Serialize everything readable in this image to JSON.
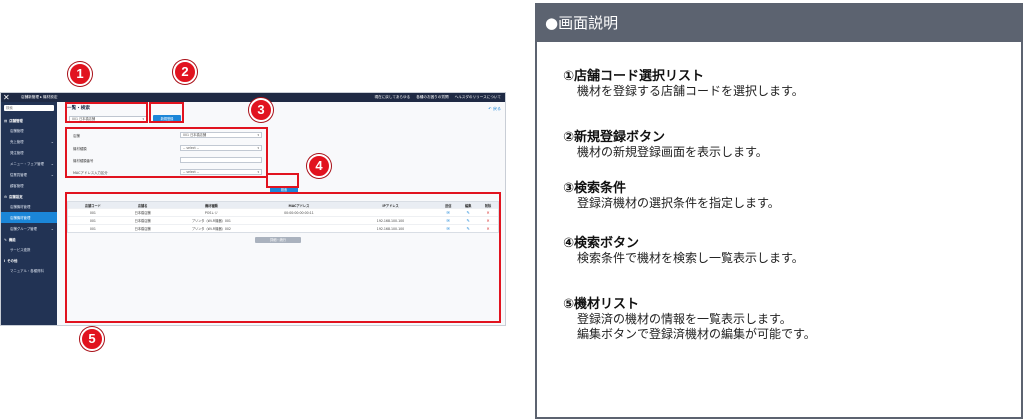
{
  "screenshot": {
    "topbar": {
      "title": "店舗新管理 ▸ 機材設定",
      "links": [
        "現在に戻してあらゆる",
        "各種のお困りの質問",
        "ヘルスダのリリースについて"
      ]
    },
    "sidebar": {
      "search_placeholder": "検索",
      "groups": [
        {
          "label": "店舗管理",
          "items": [
            {
              "label": "店舗管理",
              "active": false
            },
            {
              "label": "売上管理",
              "active": false
            },
            {
              "label": "発注管理",
              "active": false
            },
            {
              "label": "メニュー・フェア管理",
              "active": false
            },
            {
              "label": "従業員管理",
              "active": false
            },
            {
              "label": "顧客管理",
              "active": false
            }
          ]
        },
        {
          "label": "店舗設定",
          "items": [
            {
              "label": "店舗機材管理",
              "active": false
            },
            {
              "label": "店舗機材管理",
              "active": true
            },
            {
              "label": "店舗グループ管理",
              "active": false
            }
          ]
        },
        {
          "label": "機能",
          "items": [
            {
              "label": "サービス連携",
              "active": false
            }
          ]
        },
        {
          "label": "その他",
          "items": [
            {
              "label": "マニュアル・各種資料",
              "active": false
            }
          ]
        }
      ]
    },
    "main": {
      "title": "一覧・検索",
      "back": "戻る",
      "store_select": "001 日本橋店舗",
      "new_button": "新規登録",
      "conditions": [
        {
          "label": "店舗",
          "value": "001 日本橋店舗"
        },
        {
          "label": "機材種類",
          "value": "-- select --"
        },
        {
          "label": "機材種類番号",
          "value": ""
        },
        {
          "label": "MACアドレス入力区分",
          "value": "-- select --"
        }
      ],
      "search_button": "検索",
      "table": {
        "headers": [
          "店舗コード",
          "店舗名",
          "機材種類",
          "MACアドレス",
          "IPアドレス",
          "送信",
          "編集",
          "削除"
        ],
        "rows": [
          [
            "001",
            "日本橋店舗",
            "POSレジ",
            "00:00:00:00:00:11",
            ""
          ],
          [
            "001",
            "日本橋店舗",
            "プリンタ（Wi-Fi機器）001",
            "",
            "192.168.100.100"
          ],
          [
            "001",
            "日本橋店舗",
            "プリンタ（Wi-Fi機器）002",
            "",
            "192.168.100.100"
          ]
        ]
      },
      "more_button": "詳細・続行"
    }
  },
  "badges": [
    "1",
    "2",
    "3",
    "4",
    "5"
  ],
  "panel": {
    "header": "●画面説明",
    "items": [
      {
        "title": "①店舗コード選択リスト",
        "body": [
          "機材を登録する店舗コードを選択します。"
        ]
      },
      {
        "title": "②新規登録ボタン",
        "body": [
          "機材の新規登録画面を表示します。"
        ]
      },
      {
        "title": "③検索条件",
        "body": [
          "登録済機材の選択条件を指定します。"
        ]
      },
      {
        "title": "④検索ボタン",
        "body": [
          "検索条件で機材を検索し一覧表示します。"
        ]
      },
      {
        "title": "⑤機材リスト",
        "body": [
          "登録済の機材の情報を一覧表示します。",
          "編集ボタンで登録済機材の編集が可能です。"
        ]
      }
    ]
  },
  "colors": {
    "accent": "#1b86d8",
    "annotation": "#e1131f",
    "panel_header": "#5c6370",
    "sidebar": "#223354"
  }
}
